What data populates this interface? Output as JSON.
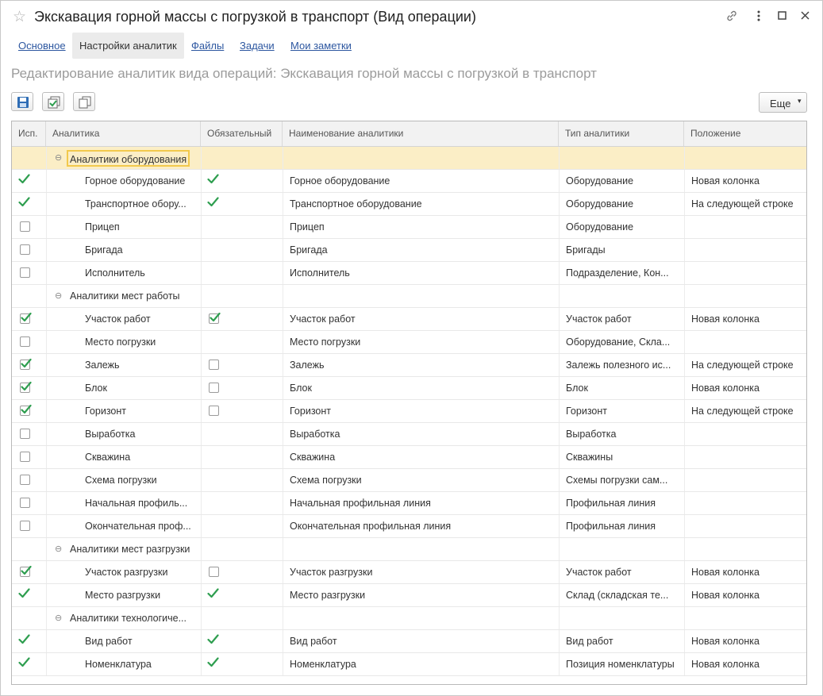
{
  "window": {
    "title": "Экскавация горной массы с погрузкой в транспорт (Вид операции)"
  },
  "tabs": [
    {
      "label": "Основное",
      "active": false
    },
    {
      "label": "Настройки аналитик",
      "active": true
    },
    {
      "label": "Файлы",
      "active": false
    },
    {
      "label": "Задачи",
      "active": false
    },
    {
      "label": "Мои заметки",
      "active": false
    }
  ],
  "subtitle": "Редактирование аналитик вида операций: Экскавация горной массы с погрузкой в транспорт",
  "toolbar": {
    "more_label": "Еще"
  },
  "colors": {
    "accent_green": "#2e9e4f",
    "link_blue": "#2d57a0",
    "selection": "#fbeec6"
  },
  "table": {
    "columns": [
      "Исп.",
      "Аналитика",
      "Обязательный",
      "Наименование аналитики",
      "Тип аналитики",
      "Положение"
    ],
    "rows": [
      {
        "kind": "group",
        "label": "Аналитики оборудования",
        "selected": true
      },
      {
        "kind": "item",
        "use": "tick",
        "label": "Горное оборудование",
        "required": "tick",
        "name": "Горное оборудование",
        "type": "Оборудование",
        "position": "Новая колонка"
      },
      {
        "kind": "item",
        "use": "tick",
        "label": "Транспортное обору...",
        "required": "tick",
        "name": "Транспортное оборудование",
        "type": "Оборудование",
        "position": "На следующей строке"
      },
      {
        "kind": "item",
        "use": "off",
        "label": "Прицеп",
        "required": "none",
        "name": "Прицеп",
        "type": "Оборудование",
        "position": ""
      },
      {
        "kind": "item",
        "use": "off",
        "label": "Бригада",
        "required": "none",
        "name": "Бригада",
        "type": "Бригады",
        "position": ""
      },
      {
        "kind": "item",
        "use": "off",
        "label": "Исполнитель",
        "required": "none",
        "name": "Исполнитель",
        "type": "Подразделение, Кон...",
        "position": ""
      },
      {
        "kind": "group",
        "label": "Аналитики мест работы",
        "selected": false
      },
      {
        "kind": "item",
        "use": "on",
        "label": "Участок работ",
        "required": "on",
        "name": "Участок работ",
        "type": "Участок работ",
        "position": "Новая колонка"
      },
      {
        "kind": "item",
        "use": "off",
        "label": "Место погрузки",
        "required": "none",
        "name": "Место погрузки",
        "type": "Оборудование, Скла...",
        "position": ""
      },
      {
        "kind": "item",
        "use": "on",
        "label": "Залежь",
        "required": "off",
        "name": "Залежь",
        "type": "Залежь полезного ис...",
        "position": "На следующей строке"
      },
      {
        "kind": "item",
        "use": "on",
        "label": "Блок",
        "required": "off",
        "name": "Блок",
        "type": "Блок",
        "position": "Новая колонка"
      },
      {
        "kind": "item",
        "use": "on",
        "label": "Горизонт",
        "required": "off",
        "name": "Горизонт",
        "type": "Горизонт",
        "position": "На следующей строке"
      },
      {
        "kind": "item",
        "use": "off",
        "label": "Выработка",
        "required": "none",
        "name": "Выработка",
        "type": "Выработка",
        "position": ""
      },
      {
        "kind": "item",
        "use": "off",
        "label": "Скважина",
        "required": "none",
        "name": "Скважина",
        "type": "Скважины",
        "position": ""
      },
      {
        "kind": "item",
        "use": "off",
        "label": "Схема погрузки",
        "required": "none",
        "name": "Схема погрузки",
        "type": "Схемы погрузки сам...",
        "position": ""
      },
      {
        "kind": "item",
        "use": "off",
        "label": "Начальная профиль...",
        "required": "none",
        "name": "Начальная профильная линия",
        "type": "Профильная линия",
        "position": ""
      },
      {
        "kind": "item",
        "use": "off",
        "label": "Окончательная проф...",
        "required": "none",
        "name": "Окончательная профильная линия",
        "type": "Профильная линия",
        "position": ""
      },
      {
        "kind": "group",
        "label": "Аналитики мест разгрузки",
        "selected": false
      },
      {
        "kind": "item",
        "use": "on",
        "label": "Участок разгрузки",
        "required": "off",
        "name": "Участок разгрузки",
        "type": "Участок работ",
        "position": "Новая колонка"
      },
      {
        "kind": "item",
        "use": "tick",
        "label": "Место разгрузки",
        "required": "tick",
        "name": "Место разгрузки",
        "type": "Склад (складская те...",
        "position": "Новая колонка"
      },
      {
        "kind": "group",
        "label": "Аналитики технологиче...",
        "selected": false
      },
      {
        "kind": "item",
        "use": "tick",
        "label": "Вид работ",
        "required": "tick",
        "name": "Вид работ",
        "type": "Вид работ",
        "position": "Новая колонка"
      },
      {
        "kind": "item",
        "use": "tick",
        "label": "Номенклатура",
        "required": "tick",
        "name": "Номенклатура",
        "type": "Позиция номенклатуры",
        "position": "Новая колонка"
      }
    ]
  }
}
